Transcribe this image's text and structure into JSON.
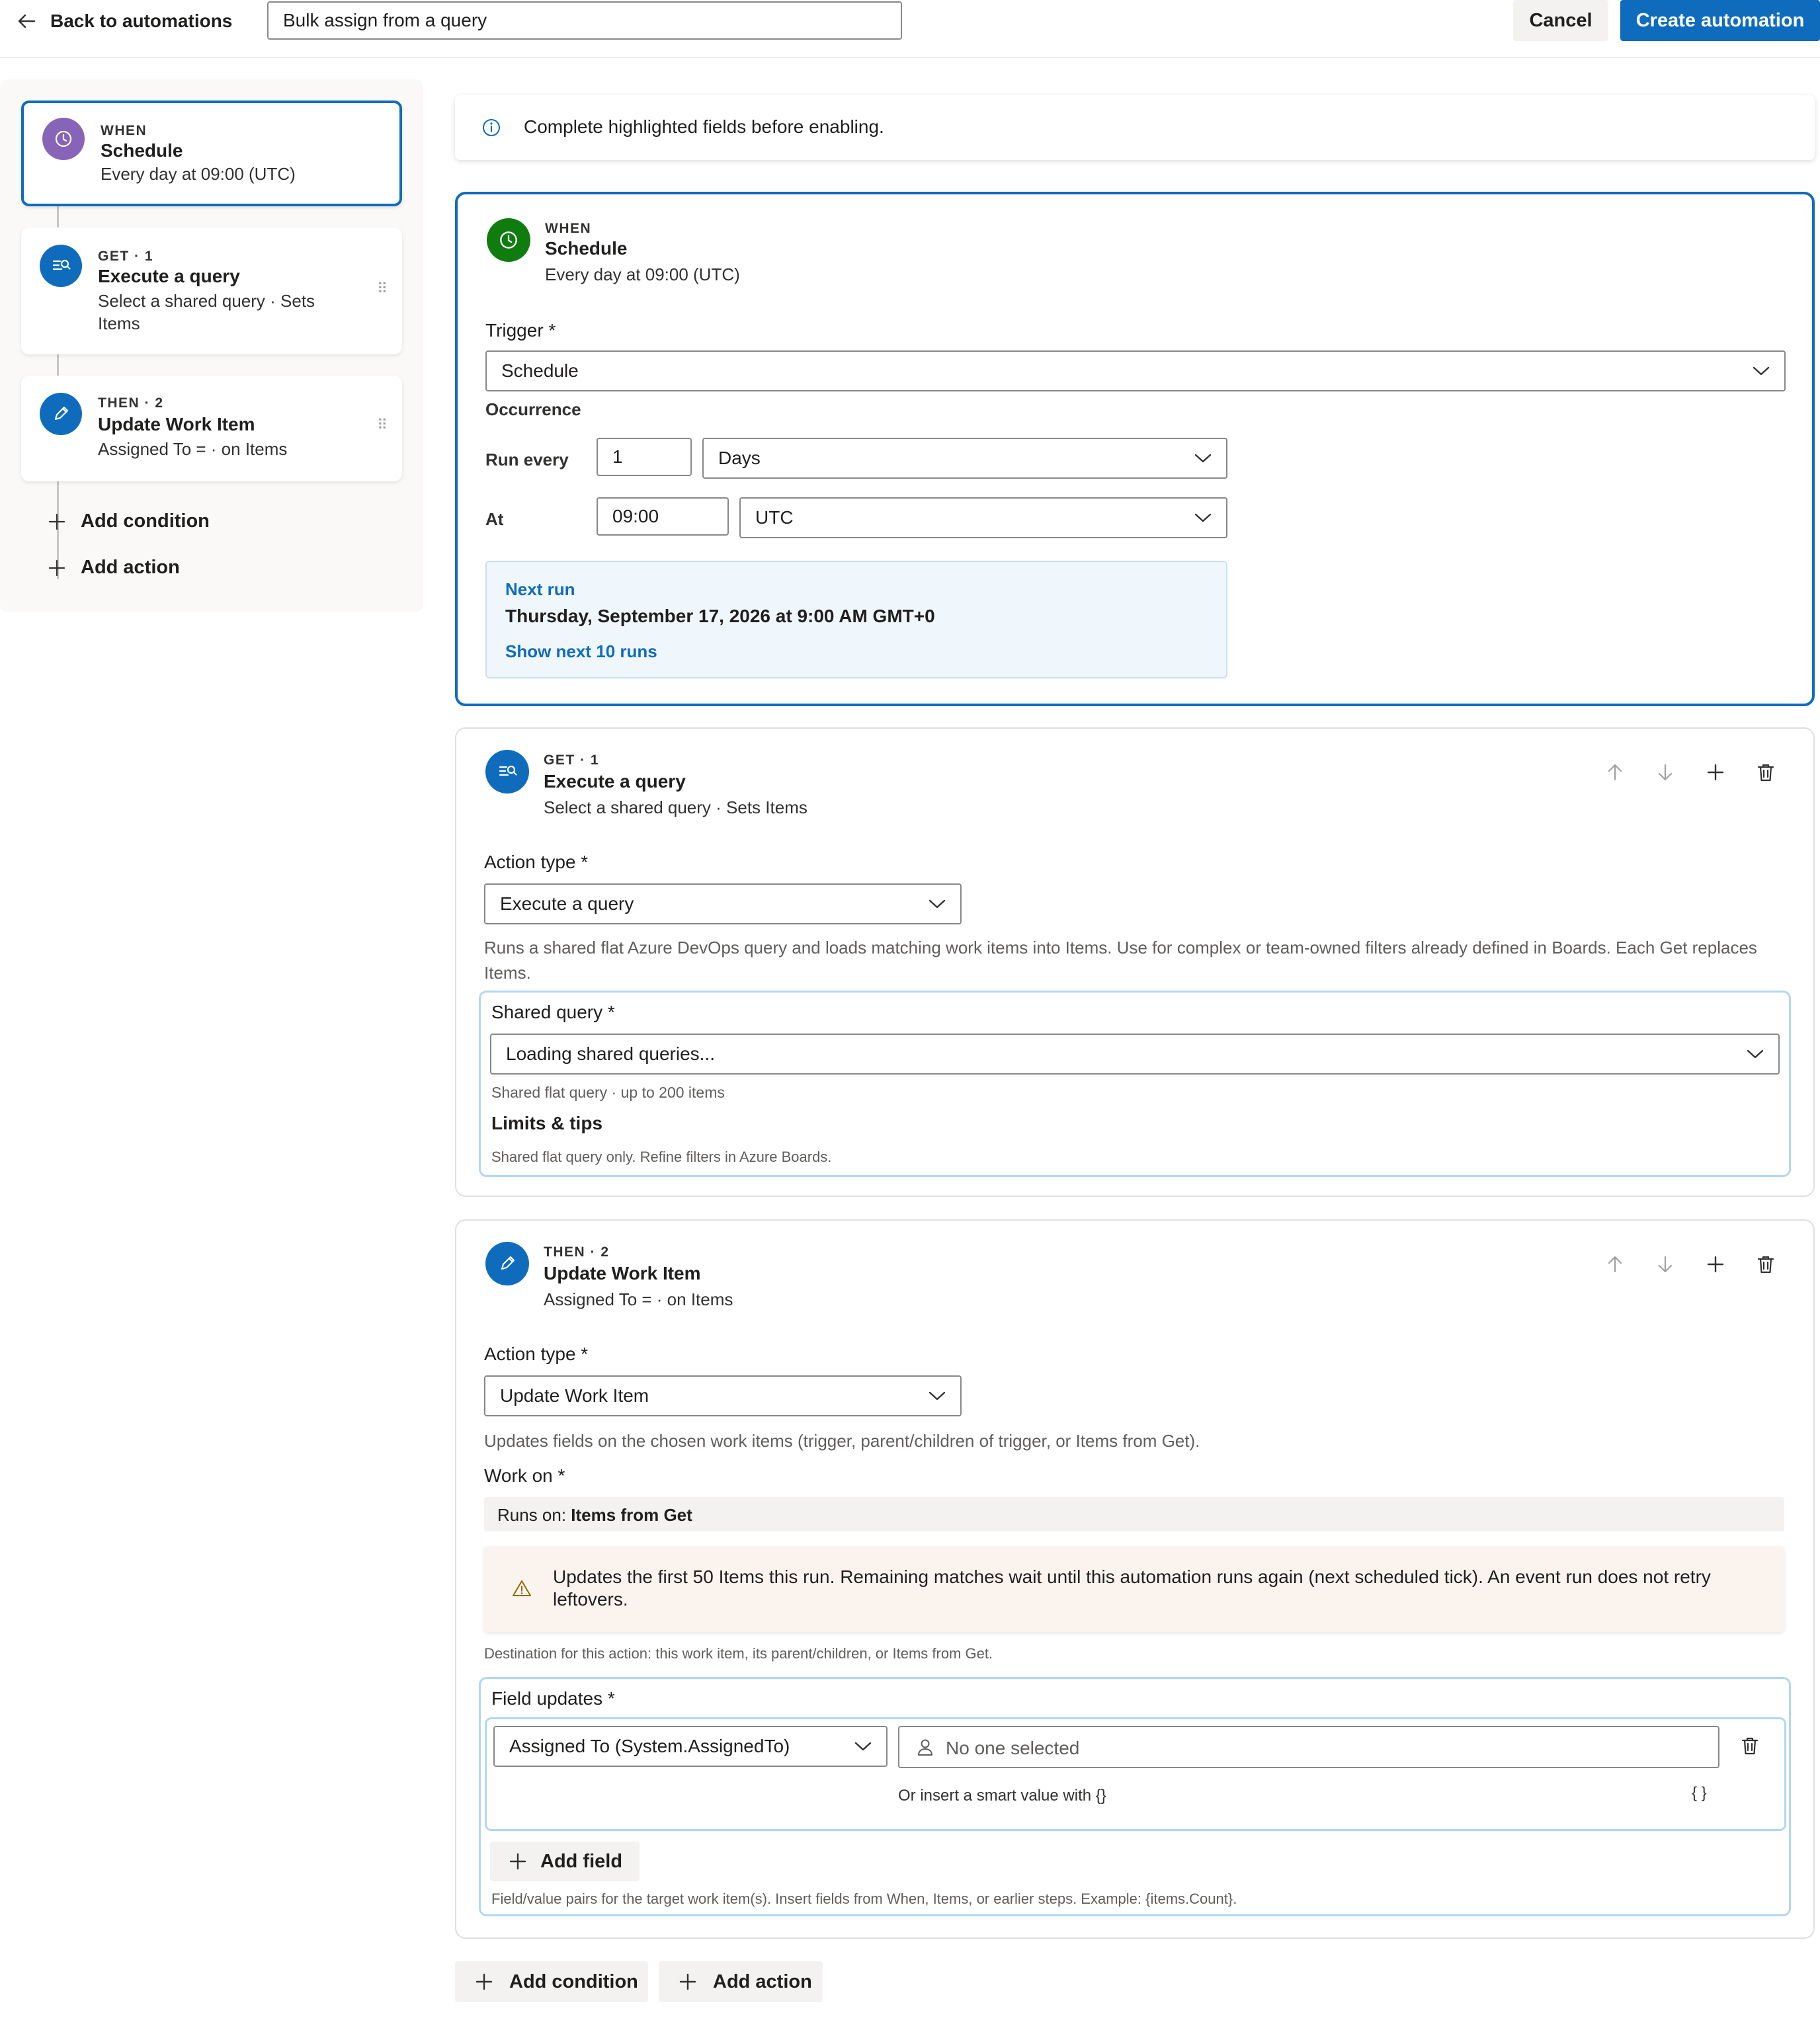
{
  "topbar": {
    "back_label": "Back to automations",
    "automation_name": "Bulk assign from a query",
    "cancel_label": "Cancel",
    "create_label": "Create automation"
  },
  "rail": {
    "nodes": [
      {
        "label": "WHEN",
        "title": "Schedule",
        "subtitle": "Every day at 09:00 (UTC)"
      },
      {
        "label": "GET · 1",
        "title": "Execute a query",
        "subtitle": "Select a shared query · Sets Items"
      },
      {
        "label": "THEN · 2",
        "title": "Update Work Item",
        "subtitle": "Assigned To = · on Items"
      }
    ],
    "add_condition": "Add condition",
    "add_action": "Add action"
  },
  "banner": {
    "text": "Complete highlighted fields before enabling."
  },
  "trigger_card": {
    "label": "WHEN",
    "title": "Schedule",
    "subtitle": "Every day at 09:00 (UTC)",
    "trigger_label": "Trigger *",
    "trigger_value": "Schedule",
    "occurrence_label": "Occurrence",
    "run_every_label": "Run every",
    "run_every_value": "1",
    "run_every_unit": "Days",
    "at_label": "At",
    "at_value": "09:00",
    "timezone": "UTC",
    "next_run_label": "Next run",
    "next_run_value": "Thursday, September 17, 2026 at 9:00 AM GMT+0",
    "show_next_runs": "Show next 10 runs"
  },
  "get_card": {
    "label": "GET · 1",
    "title": "Execute a query",
    "subtitle": "Select a shared query · Sets Items",
    "action_type_label": "Action type *",
    "action_type_value": "Execute a query",
    "description": "Runs a shared flat Azure DevOps query and loads matching work items into Items. Use for complex or team-owned filters already defined in Boards. Each Get replaces Items.",
    "shared_query_label": "Shared query *",
    "shared_query_value": "Loading shared queries...",
    "shared_query_hint": "Shared flat query · up to 200 items",
    "limits_title": "Limits & tips",
    "limits_text": "Shared flat query only. Refine filters in Azure Boards."
  },
  "update_card": {
    "label": "THEN · 2",
    "title": "Update Work Item",
    "subtitle": "Assigned To = · on Items",
    "action_type_label": "Action type *",
    "action_type_value": "Update Work Item",
    "description": "Updates fields on the chosen work items (trigger, parent/children of trigger, or Items from Get).",
    "work_on_label": "Work on *",
    "runs_on_prefix": "Runs on: ",
    "runs_on_value": "Items from Get",
    "warning": "Updates the first 50 Items this run. Remaining matches wait until this automation runs again (next scheduled tick). An event run does not retry leftovers.",
    "destination_hint": "Destination for this action: this work item, its parent/children, or Items from Get.",
    "field_updates_label": "Field updates *",
    "field_name": "Assigned To (System.AssignedTo)",
    "field_value_placeholder": "No one selected",
    "smart_value_hint": "Or insert a smart value with {}",
    "smart_value_button": "{ }",
    "add_field": "Add field",
    "field_updates_help": "Field/value pairs for the target work item(s). Insert fields from When, Items, or earlier steps. Example: {items.Count}."
  },
  "footer": {
    "add_condition": "Add condition",
    "add_action": "Add action"
  },
  "colors": {
    "accent": "#0f6cbd",
    "schedule_purple": "#8764b8",
    "schedule_green": "#107c10",
    "warning_bg": "#fbf3ee"
  },
  "icons": [
    "arrow-left-icon",
    "clock-icon",
    "query-icon",
    "pencil-icon",
    "plus-icon",
    "info-icon",
    "chevron-down-icon",
    "arrow-up-icon",
    "arrow-down-icon",
    "trash-icon",
    "warning-icon",
    "person-icon",
    "grip-icon"
  ]
}
